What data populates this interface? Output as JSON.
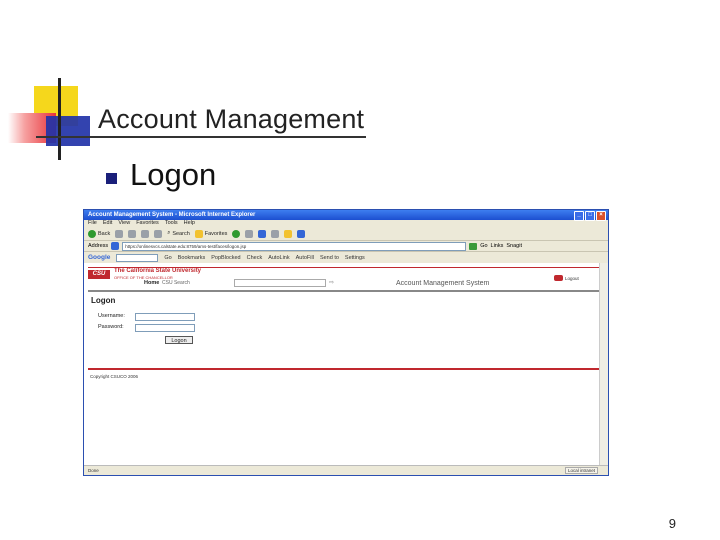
{
  "slide": {
    "title": "Account Management",
    "bullet": "Logon",
    "page_number": "9"
  },
  "browser": {
    "window_title": "Account Management System - Microsoft Internet Explorer",
    "menu": [
      "File",
      "Edit",
      "View",
      "Favorites",
      "Tools",
      "Help"
    ],
    "toolbar": {
      "back": "Back",
      "search": "Search",
      "favorites": "Favorites"
    },
    "address_label": "Address",
    "address_value": "https://onlinesvcs.calstate.edu:8759/ams-test/faces/logon.jsp",
    "go_label": "Go",
    "links_label": "Links",
    "snagit_label": "Snagit",
    "settings_label": "Settings",
    "google": {
      "logo": "Google",
      "go_label": "Go",
      "bookmarks": "Bookmarks",
      "popups": "PopBlocked",
      "check": "Check",
      "autolink": "AutoLink",
      "autofill": "AutoFill",
      "sendto": "Send to"
    },
    "status_left": "Done",
    "status_right": "Local intranet"
  },
  "page": {
    "org_name": "The California State University",
    "org_sub": "OFFICE OF THE CHANCELLOR",
    "logo_text": "CSU",
    "nav_home": "Home",
    "nav_search": "CSU Search",
    "app_title": "Account Management System",
    "logout": "Logout",
    "heading": "Logon",
    "username_label": "Username:",
    "password_label": "Password:",
    "logon_button": "Logon",
    "copyright": "Copyright CSUCO 2006"
  }
}
